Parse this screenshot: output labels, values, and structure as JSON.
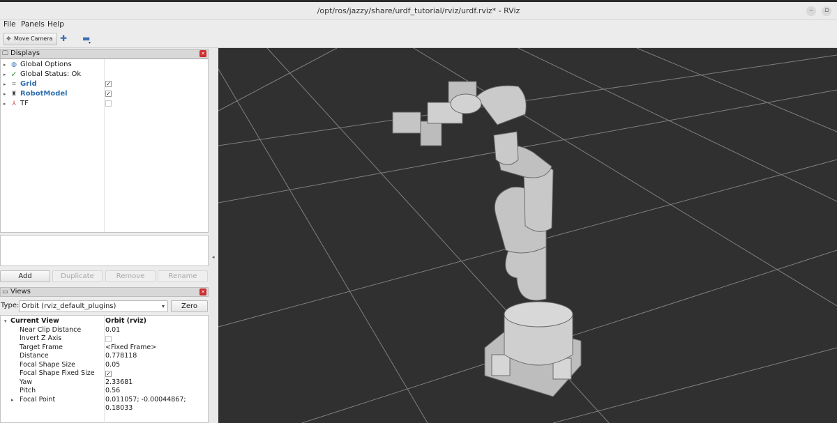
{
  "window": {
    "title": "/opt/ros/jazzy/share/urdf_tutorial/rviz/urdf.rviz* - RViz",
    "minimize_glyph": "–",
    "restore_glyph": "▫"
  },
  "menubar": {
    "items": [
      {
        "label": "File"
      },
      {
        "label": "Panels"
      },
      {
        "label": "Help"
      }
    ]
  },
  "toolbar": {
    "move_camera_label": "Move Camera",
    "add_tool_icon": "crosshair-plus-icon",
    "remove_tool_icon": "minus-icon"
  },
  "displays": {
    "title": "Displays",
    "tree": [
      {
        "label": "Global Options",
        "icon": "globe-icon",
        "bold": false
      },
      {
        "label": "Global Status: Ok",
        "icon": "checkmark-icon",
        "bold": false
      },
      {
        "label": "Grid",
        "icon": "grid-icon",
        "bold": true,
        "checked": true
      },
      {
        "label": "RobotModel",
        "icon": "robot-icon",
        "bold": true,
        "checked": true
      },
      {
        "label": "TF",
        "icon": "tf-axes-icon",
        "bold": false,
        "checked": false
      }
    ],
    "buttons": {
      "add": "Add",
      "duplicate": "Duplicate",
      "remove": "Remove",
      "rename": "Rename"
    }
  },
  "views": {
    "title": "Views",
    "type_label": "Type:",
    "type_value": "Orbit (rviz_default_plugins)",
    "zero_label": "Zero",
    "current_view": {
      "label": "Current View",
      "value": "Orbit (rviz)"
    },
    "properties": [
      {
        "key": "Near Clip Distance",
        "value": "0.01"
      },
      {
        "key": "Invert Z Axis",
        "value": "",
        "checkbox": true,
        "checked": false
      },
      {
        "key": "Target Frame",
        "value": "<Fixed Frame>"
      },
      {
        "key": "Distance",
        "value": "0.778118"
      },
      {
        "key": "Focal Shape Size",
        "value": "0.05"
      },
      {
        "key": "Focal Shape Fixed Size",
        "value": "",
        "checkbox": true,
        "checked": true
      },
      {
        "key": "Yaw",
        "value": "2.33681"
      },
      {
        "key": "Pitch",
        "value": "0.56"
      },
      {
        "key": "Focal Point",
        "value": "0.011057; -0.00044867; 0.18033",
        "expandable": true
      }
    ]
  },
  "viewport": {
    "background": "#303030",
    "grid_color": "#a0a0a0",
    "robot_color": "#c8c8c8"
  }
}
